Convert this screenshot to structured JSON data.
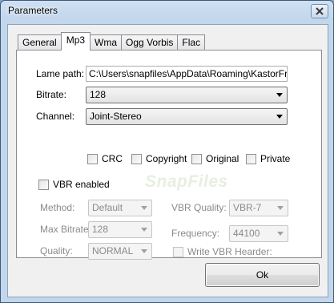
{
  "window": {
    "title": "Parameters"
  },
  "tabs": [
    "General",
    "Mp3",
    "Wma",
    "Ogg Vorbis",
    "Flac"
  ],
  "active_tab": "Mp3",
  "lame_path": {
    "label": "Lame path:",
    "value": "C:\\Users\\snapfiles\\AppData\\Roaming\\KastorFreeAu"
  },
  "bitrate": {
    "label": "Bitrate:",
    "value": "128"
  },
  "channel": {
    "label": "Channel:",
    "value": "Joint-Stereo"
  },
  "flags": {
    "crc": "CRC",
    "copyright": "Copyright",
    "original": "Original",
    "private": "Private"
  },
  "vbr_enabled": {
    "label": "VBR enabled",
    "checked": false
  },
  "method": {
    "label": "Method:",
    "value": "Default"
  },
  "max_bitrate": {
    "label": "Max Bitrate:",
    "value": "128"
  },
  "quality": {
    "label": "Quality:",
    "value": "NORMAL"
  },
  "vbr_quality": {
    "label": "VBR Quality:",
    "value": "VBR-7"
  },
  "frequency": {
    "label": "Frequency:",
    "value": "44100"
  },
  "write_vbr_header": {
    "label": "Write VBR Hearder:",
    "checked": false
  },
  "watermark": "SnapFiles",
  "buttons": {
    "ok": "Ok"
  }
}
